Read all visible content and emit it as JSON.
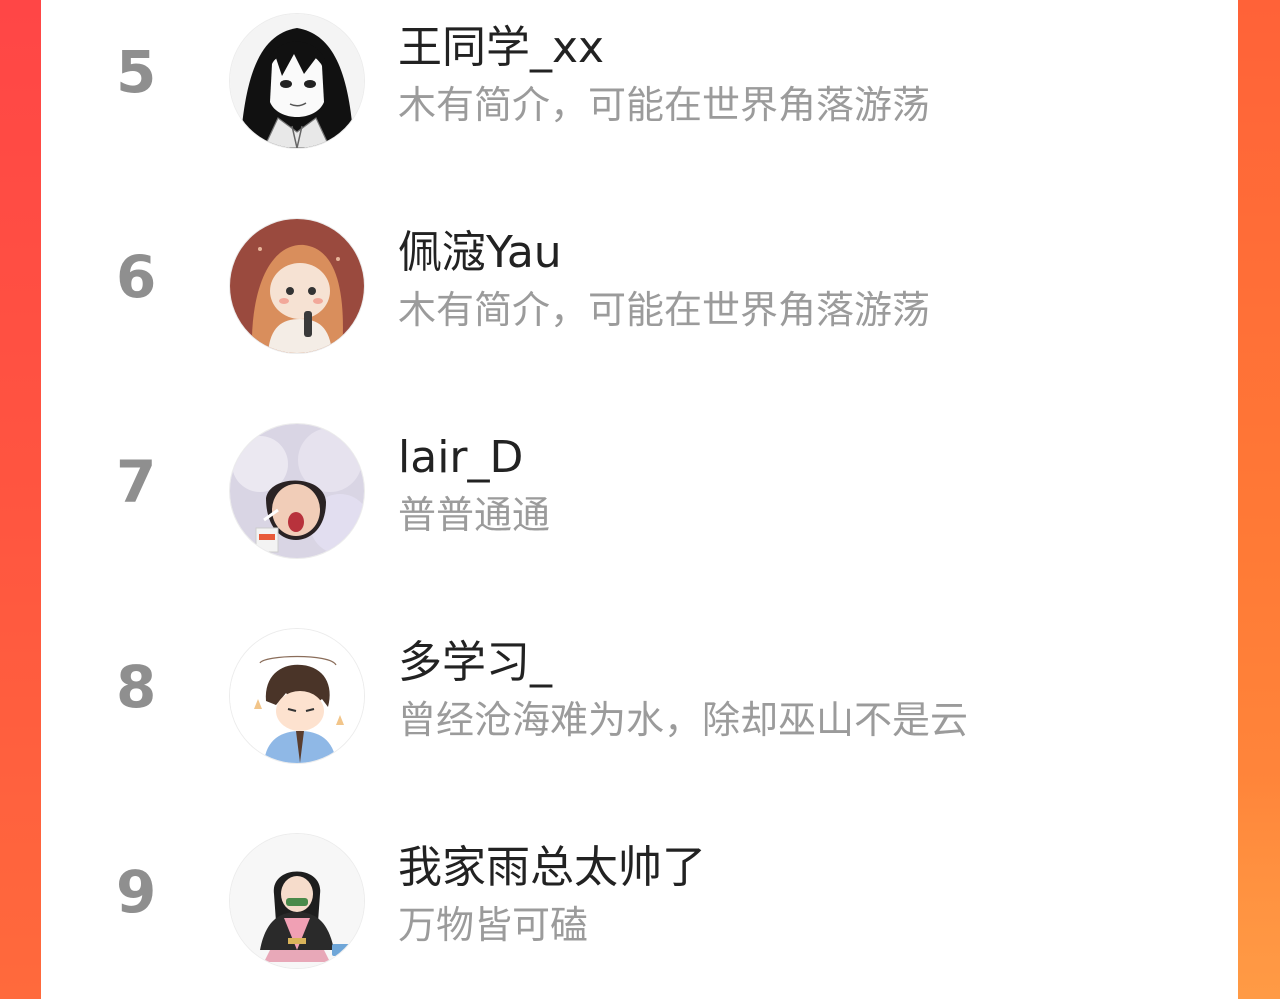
{
  "ranking": {
    "items": [
      {
        "rank": "5",
        "name": "王同学_xx",
        "bio": "木有简介，可能在世界角落游荡",
        "avatar_icon": "avatar-manga-girl-icon"
      },
      {
        "rank": "6",
        "name": "佩滱Yau",
        "bio": "木有简介，可能在世界角落游荡",
        "avatar_icon": "avatar-illustrated-girl-icon"
      },
      {
        "rank": "7",
        "name": "lair_D",
        "bio": "普普通通",
        "avatar_icon": "avatar-photo-girl-icon"
      },
      {
        "rank": "8",
        "name": "多学习_",
        "bio": "曾经沧海难为水，除却巫山不是云",
        "avatar_icon": "avatar-cartoon-boy-icon"
      },
      {
        "rank": "9",
        "name": "我家雨总太帅了",
        "bio": "万物皆可磕",
        "avatar_icon": "avatar-anime-figure-icon"
      }
    ]
  },
  "colors": {
    "rank": "#8f8f8f",
    "name": "#222222",
    "bio": "#9b9b9b",
    "frame_accent": "#ff5a40"
  }
}
